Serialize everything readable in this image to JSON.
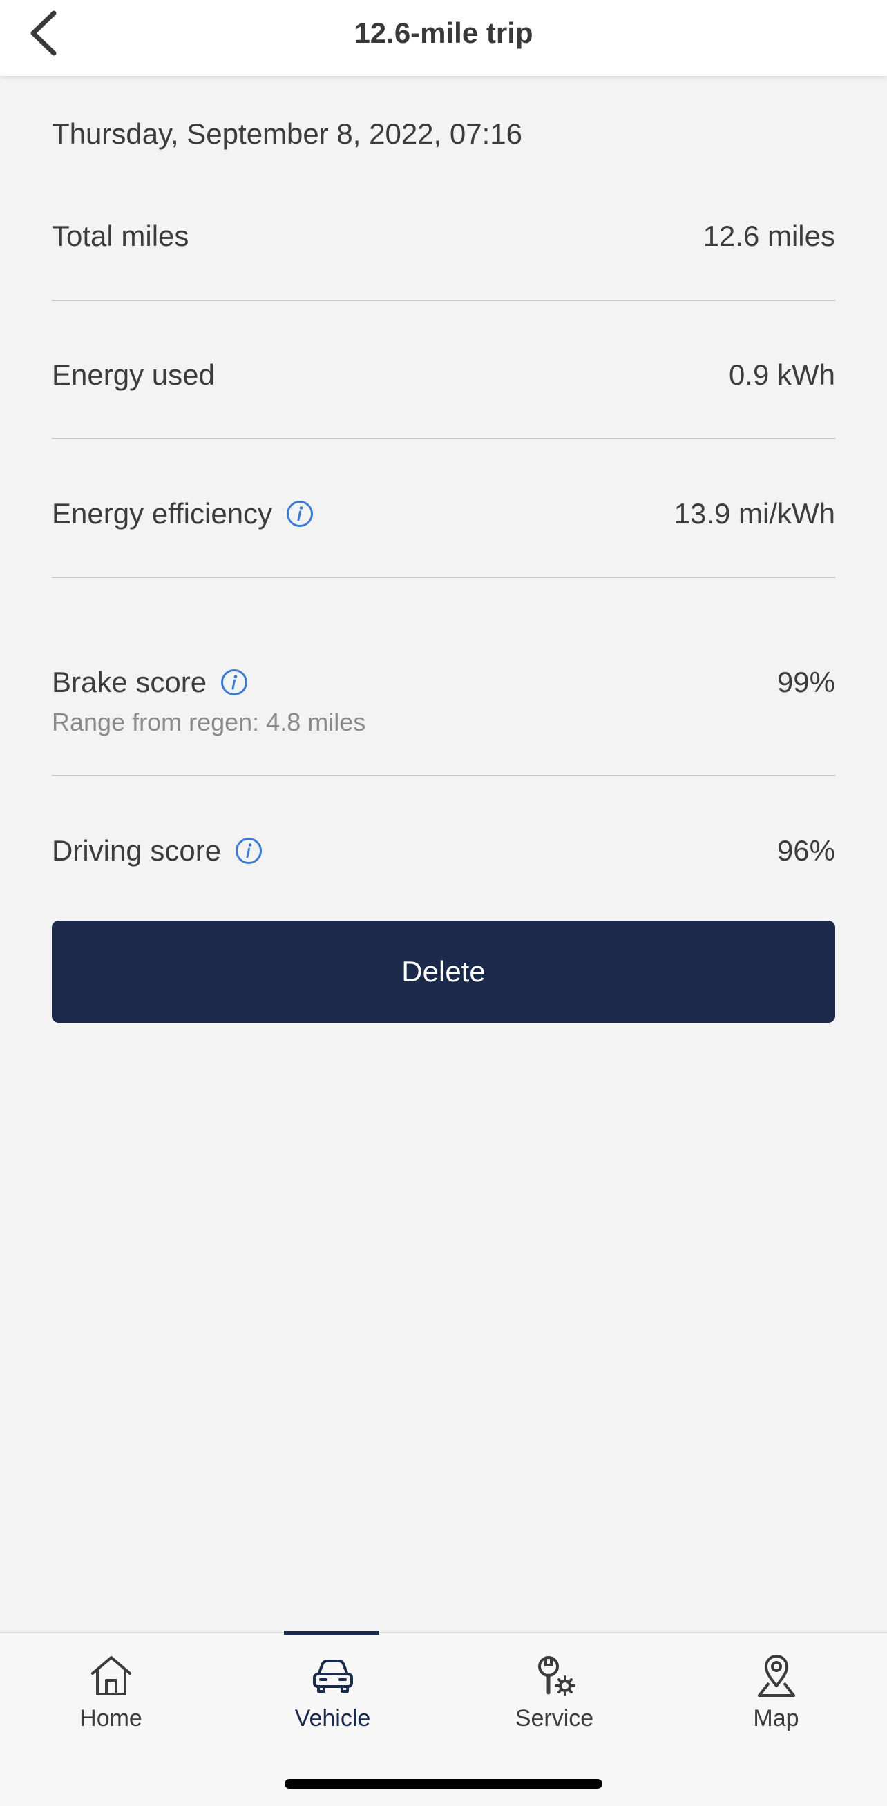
{
  "header": {
    "title": "12.6-mile trip",
    "back_icon": "chevron-left-icon"
  },
  "trip": {
    "date": "Thursday, September 8, 2022, 07:16",
    "rows": [
      {
        "label": "Total miles",
        "value": "12.6 miles",
        "info": false
      },
      {
        "label": "Energy used",
        "value": "0.9 kWh",
        "info": false
      },
      {
        "label": "Energy efficiency",
        "value": "13.9 mi/kWh",
        "info": true
      },
      {
        "label": "Brake score",
        "value": "99%",
        "info": true,
        "subtext": "Range from regen: 4.8 miles"
      },
      {
        "label": "Driving score",
        "value": "96%",
        "info": true
      }
    ],
    "delete_label": "Delete"
  },
  "nav": {
    "active": "Vehicle",
    "items": [
      {
        "label": "Home",
        "icon": "home-icon"
      },
      {
        "label": "Vehicle",
        "icon": "car-icon"
      },
      {
        "label": "Service",
        "icon": "service-icon"
      },
      {
        "label": "Map",
        "icon": "map-pin-icon"
      }
    ]
  },
  "colors": {
    "primary": "#1b2a4a",
    "info_icon": "#3a7bd5",
    "background": "#f3f3f3"
  }
}
